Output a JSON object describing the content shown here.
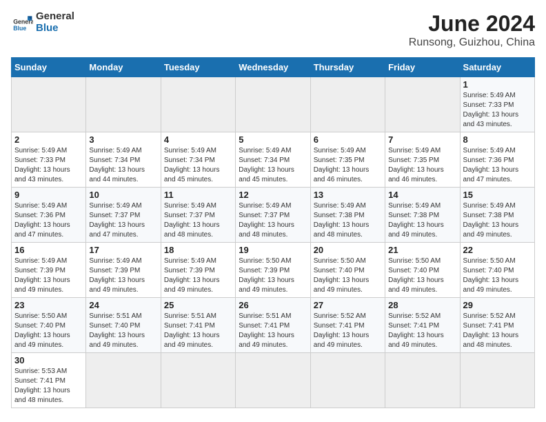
{
  "header": {
    "logo_general": "General",
    "logo_blue": "Blue",
    "month_year": "June 2024",
    "location": "Runsong, Guizhou, China"
  },
  "weekdays": [
    "Sunday",
    "Monday",
    "Tuesday",
    "Wednesday",
    "Thursday",
    "Friday",
    "Saturday"
  ],
  "weeks": [
    [
      {
        "day": "",
        "empty": true
      },
      {
        "day": "",
        "empty": true
      },
      {
        "day": "",
        "empty": true
      },
      {
        "day": "",
        "empty": true
      },
      {
        "day": "",
        "empty": true
      },
      {
        "day": "",
        "empty": true
      },
      {
        "day": "1",
        "sunrise": "5:49 AM",
        "sunset": "7:33 PM",
        "daylight": "13 hours and 43 minutes."
      }
    ],
    [
      {
        "day": "2",
        "sunrise": "5:49 AM",
        "sunset": "7:33 PM",
        "daylight": "13 hours and 43 minutes."
      },
      {
        "day": "3",
        "sunrise": "5:49 AM",
        "sunset": "7:34 PM",
        "daylight": "13 hours and 44 minutes."
      },
      {
        "day": "4",
        "sunrise": "5:49 AM",
        "sunset": "7:34 PM",
        "daylight": "13 hours and 45 minutes."
      },
      {
        "day": "5",
        "sunrise": "5:49 AM",
        "sunset": "7:34 PM",
        "daylight": "13 hours and 45 minutes."
      },
      {
        "day": "6",
        "sunrise": "5:49 AM",
        "sunset": "7:35 PM",
        "daylight": "13 hours and 46 minutes."
      },
      {
        "day": "7",
        "sunrise": "5:49 AM",
        "sunset": "7:35 PM",
        "daylight": "13 hours and 46 minutes."
      },
      {
        "day": "8",
        "sunrise": "5:49 AM",
        "sunset": "7:36 PM",
        "daylight": "13 hours and 47 minutes."
      }
    ],
    [
      {
        "day": "9",
        "sunrise": "5:49 AM",
        "sunset": "7:36 PM",
        "daylight": "13 hours and 47 minutes."
      },
      {
        "day": "10",
        "sunrise": "5:49 AM",
        "sunset": "7:37 PM",
        "daylight": "13 hours and 47 minutes."
      },
      {
        "day": "11",
        "sunrise": "5:49 AM",
        "sunset": "7:37 PM",
        "daylight": "13 hours and 48 minutes."
      },
      {
        "day": "12",
        "sunrise": "5:49 AM",
        "sunset": "7:37 PM",
        "daylight": "13 hours and 48 minutes."
      },
      {
        "day": "13",
        "sunrise": "5:49 AM",
        "sunset": "7:38 PM",
        "daylight": "13 hours and 48 minutes."
      },
      {
        "day": "14",
        "sunrise": "5:49 AM",
        "sunset": "7:38 PM",
        "daylight": "13 hours and 49 minutes."
      },
      {
        "day": "15",
        "sunrise": "5:49 AM",
        "sunset": "7:38 PM",
        "daylight": "13 hours and 49 minutes."
      }
    ],
    [
      {
        "day": "16",
        "sunrise": "5:49 AM",
        "sunset": "7:39 PM",
        "daylight": "13 hours and 49 minutes."
      },
      {
        "day": "17",
        "sunrise": "5:49 AM",
        "sunset": "7:39 PM",
        "daylight": "13 hours and 49 minutes."
      },
      {
        "day": "18",
        "sunrise": "5:49 AM",
        "sunset": "7:39 PM",
        "daylight": "13 hours and 49 minutes."
      },
      {
        "day": "19",
        "sunrise": "5:50 AM",
        "sunset": "7:39 PM",
        "daylight": "13 hours and 49 minutes."
      },
      {
        "day": "20",
        "sunrise": "5:50 AM",
        "sunset": "7:40 PM",
        "daylight": "13 hours and 49 minutes."
      },
      {
        "day": "21",
        "sunrise": "5:50 AM",
        "sunset": "7:40 PM",
        "daylight": "13 hours and 49 minutes."
      },
      {
        "day": "22",
        "sunrise": "5:50 AM",
        "sunset": "7:40 PM",
        "daylight": "13 hours and 49 minutes."
      }
    ],
    [
      {
        "day": "23",
        "sunrise": "5:50 AM",
        "sunset": "7:40 PM",
        "daylight": "13 hours and 49 minutes."
      },
      {
        "day": "24",
        "sunrise": "5:51 AM",
        "sunset": "7:40 PM",
        "daylight": "13 hours and 49 minutes."
      },
      {
        "day": "25",
        "sunrise": "5:51 AM",
        "sunset": "7:41 PM",
        "daylight": "13 hours and 49 minutes."
      },
      {
        "day": "26",
        "sunrise": "5:51 AM",
        "sunset": "7:41 PM",
        "daylight": "13 hours and 49 minutes."
      },
      {
        "day": "27",
        "sunrise": "5:52 AM",
        "sunset": "7:41 PM",
        "daylight": "13 hours and 49 minutes."
      },
      {
        "day": "28",
        "sunrise": "5:52 AM",
        "sunset": "7:41 PM",
        "daylight": "13 hours and 49 minutes."
      },
      {
        "day": "29",
        "sunrise": "5:52 AM",
        "sunset": "7:41 PM",
        "daylight": "13 hours and 48 minutes."
      }
    ],
    [
      {
        "day": "30",
        "sunrise": "5:53 AM",
        "sunset": "7:41 PM",
        "daylight": "13 hours and 48 minutes."
      },
      {
        "day": "",
        "empty": true
      },
      {
        "day": "",
        "empty": true
      },
      {
        "day": "",
        "empty": true
      },
      {
        "day": "",
        "empty": true
      },
      {
        "day": "",
        "empty": true
      },
      {
        "day": "",
        "empty": true
      }
    ]
  ],
  "labels": {
    "sunrise": "Sunrise:",
    "sunset": "Sunset:",
    "daylight": "Daylight: "
  }
}
